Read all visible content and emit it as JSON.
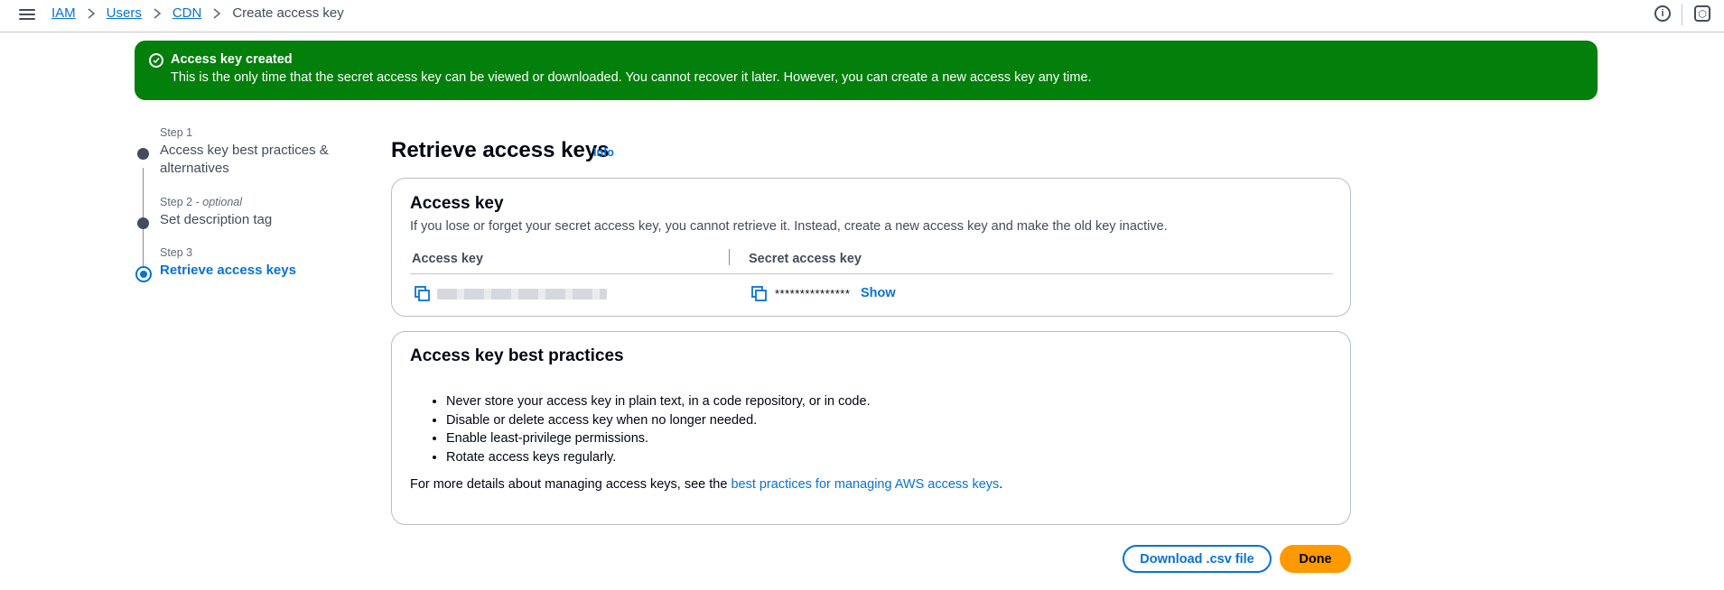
{
  "header": {
    "breadcrumbs": [
      "IAM",
      "Users",
      "CDN"
    ],
    "current": "Create access key"
  },
  "banner": {
    "title": "Access key created",
    "text": "This is the only time that the secret access key can be viewed or downloaded. You cannot recover it later. However, you can create a new access key any time."
  },
  "steps": [
    {
      "label": "Step 1",
      "title": "Access key best practices & alternatives"
    },
    {
      "label": "Step 2",
      "optional": "optional",
      "title": "Set description tag"
    },
    {
      "label": "Step 3",
      "title": "Retrieve access keys"
    }
  ],
  "page": {
    "title": "Retrieve access keys",
    "info": "Info"
  },
  "access_key_card": {
    "title": "Access key",
    "description": "If you lose or forget your secret access key, you cannot retrieve it. Instead, create a new access key and make the old key inactive.",
    "col_access_key": "Access key",
    "col_secret_key": "Secret access key",
    "secret_masked": "***************",
    "show_label": "Show"
  },
  "best_practices_card": {
    "title": "Access key best practices",
    "items": [
      "Never store your access key in plain text, in a code repository, or in code.",
      "Disable or delete access key when no longer needed.",
      "Enable least-privilege permissions.",
      "Rotate access keys regularly."
    ],
    "footer_prefix": "For more details about managing access keys, see the",
    "footer_link": "best practices for managing AWS access keys",
    "footer_suffix": "."
  },
  "actions": {
    "download": "Download .csv file",
    "done": "Done"
  }
}
